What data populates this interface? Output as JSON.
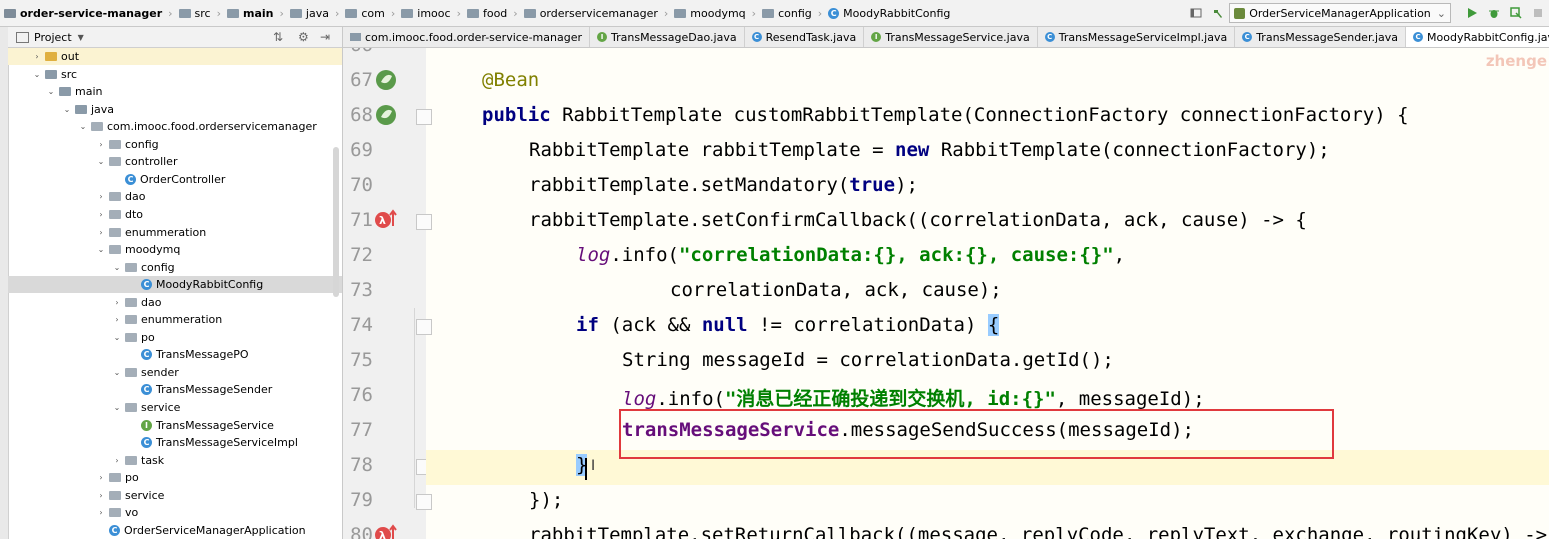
{
  "navbar": {
    "crumbs": [
      "order-service-manager",
      "src",
      "main",
      "java",
      "com",
      "imooc",
      "food",
      "orderservicemanager",
      "moodymq",
      "config",
      "MoodyRabbitConfig"
    ],
    "run_config": "OrderServiceManagerApplication"
  },
  "project": {
    "header": "Project",
    "tree": [
      {
        "label": "out",
        "arrow": "›",
        "icon": "folder-out"
      },
      {
        "label": "src",
        "arrow": "⌄",
        "icon": "folder"
      },
      {
        "label": "main",
        "arrow": "⌄",
        "icon": "folder"
      },
      {
        "label": "java",
        "arrow": "⌄",
        "icon": "folder"
      },
      {
        "label": "com.imooc.food.orderservicemanager",
        "arrow": "⌄",
        "icon": "package"
      },
      {
        "label": "config",
        "arrow": "›",
        "icon": "package"
      },
      {
        "label": "controller",
        "arrow": "⌄",
        "icon": "package"
      },
      {
        "label": "OrderController",
        "arrow": "",
        "icon": "class"
      },
      {
        "label": "dao",
        "arrow": "›",
        "icon": "package"
      },
      {
        "label": "dto",
        "arrow": "›",
        "icon": "package"
      },
      {
        "label": "enummeration",
        "arrow": "›",
        "icon": "package"
      },
      {
        "label": "moodymq",
        "arrow": "⌄",
        "icon": "package"
      },
      {
        "label": "config",
        "arrow": "⌄",
        "icon": "package"
      },
      {
        "label": "MoodyRabbitConfig",
        "arrow": "",
        "icon": "class"
      },
      {
        "label": "dao",
        "arrow": "›",
        "icon": "package"
      },
      {
        "label": "enummeration",
        "arrow": "›",
        "icon": "package"
      },
      {
        "label": "po",
        "arrow": "⌄",
        "icon": "package"
      },
      {
        "label": "TransMessagePO",
        "arrow": "",
        "icon": "class"
      },
      {
        "label": "sender",
        "arrow": "⌄",
        "icon": "package"
      },
      {
        "label": "TransMessageSender",
        "arrow": "",
        "icon": "class"
      },
      {
        "label": "service",
        "arrow": "⌄",
        "icon": "package"
      },
      {
        "label": "TransMessageService",
        "arrow": "",
        "icon": "interface"
      },
      {
        "label": "TransMessageServiceImpl",
        "arrow": "",
        "icon": "class"
      },
      {
        "label": "task",
        "arrow": "›",
        "icon": "package"
      },
      {
        "label": "po",
        "arrow": "›",
        "icon": "package"
      },
      {
        "label": "service",
        "arrow": "›",
        "icon": "package"
      },
      {
        "label": "vo",
        "arrow": "›",
        "icon": "package"
      },
      {
        "label": "OrderServiceManagerApplication",
        "arrow": "",
        "icon": "class"
      }
    ]
  },
  "tabs": [
    {
      "label": "com.imooc.food.order-service-manager",
      "icon": "module"
    },
    {
      "label": "TransMessageDao.java",
      "icon": "interface"
    },
    {
      "label": "ResendTask.java",
      "icon": "class"
    },
    {
      "label": "TransMessageService.java",
      "icon": "interface"
    },
    {
      "label": "TransMessageServiceImpl.java",
      "icon": "class"
    },
    {
      "label": "TransMessageSender.java",
      "icon": "class"
    },
    {
      "label": "MoodyRabbitConfig.java",
      "icon": "class"
    }
  ],
  "editor": {
    "line_numbers": [
      "66",
      "67",
      "68",
      "69",
      "70",
      "71",
      "72",
      "73",
      "74",
      "75",
      "76",
      "77",
      "78",
      "79",
      "80"
    ],
    "watermark": "zhenge"
  },
  "colors": {
    "highlight_box": "#e0393e",
    "keyword": "#000080",
    "string": "#008000",
    "annotation": "#808000"
  }
}
